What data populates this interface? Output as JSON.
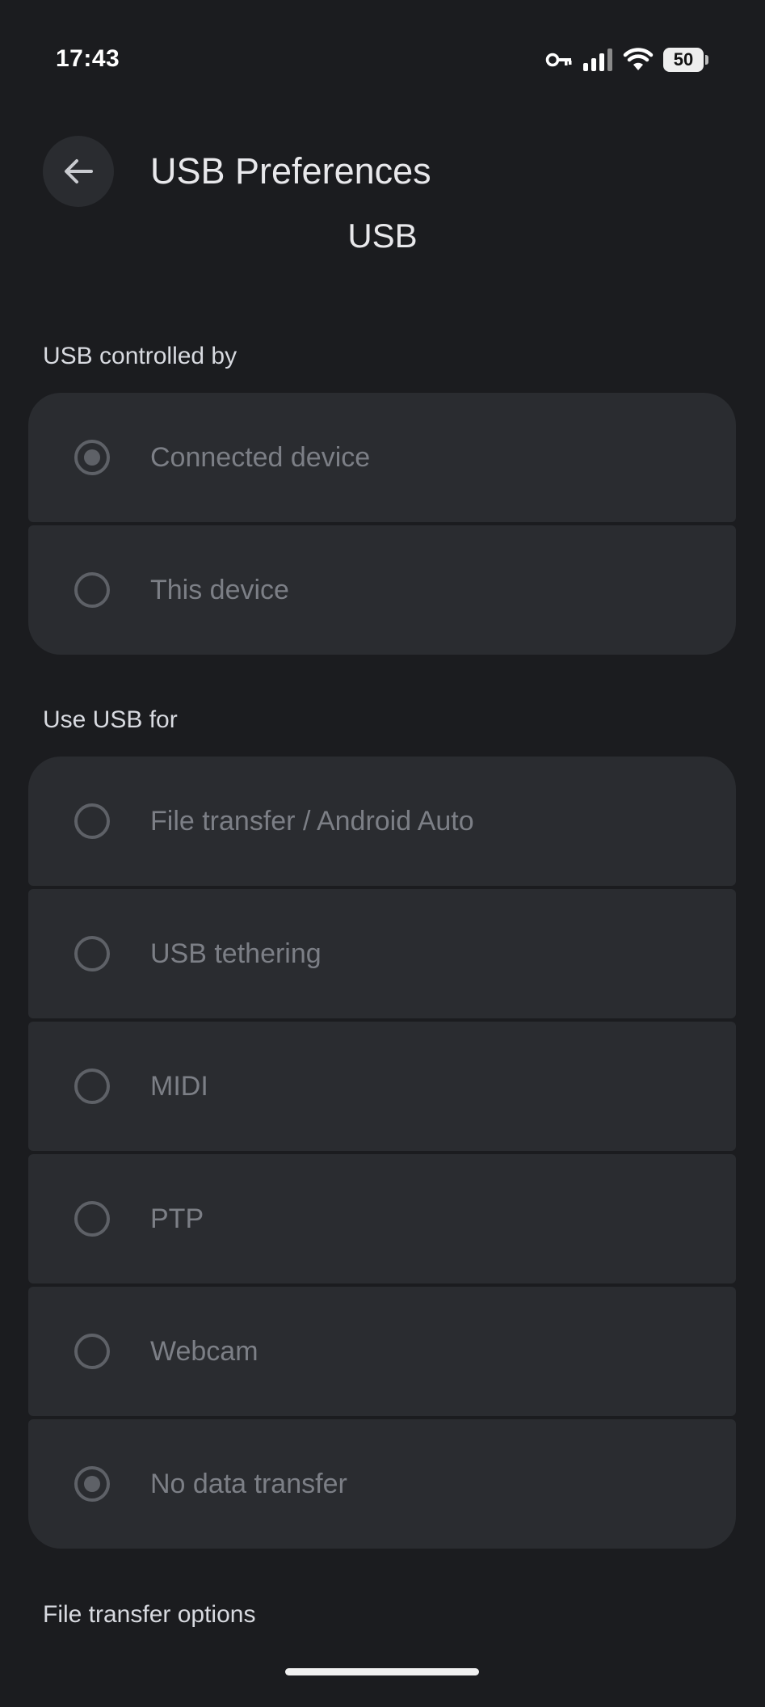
{
  "status_bar": {
    "time": "17:43",
    "battery_level": "50",
    "icons": [
      "vpn-key-icon",
      "cellular-signal-icon",
      "wifi-icon",
      "battery-icon"
    ]
  },
  "header": {
    "back_icon": "arrow-back-icon",
    "title": "USB Preferences",
    "subtitle": "USB"
  },
  "controlled_by": {
    "label": "USB controlled by",
    "options": [
      {
        "label": "Connected device",
        "checked": true
      },
      {
        "label": "This device",
        "checked": false
      }
    ]
  },
  "use_usb_for": {
    "label": "Use USB for",
    "options": [
      {
        "label": "File transfer / Android Auto",
        "checked": false
      },
      {
        "label": "USB tethering",
        "checked": false
      },
      {
        "label": "MIDI",
        "checked": false
      },
      {
        "label": "PTP",
        "checked": false
      },
      {
        "label": "Webcam",
        "checked": false
      },
      {
        "label": "No data transfer",
        "checked": true
      }
    ]
  },
  "file_transfer_options": {
    "label": "File transfer options"
  },
  "colors": {
    "background": "#1b1c1f",
    "card": "#2a2c30",
    "disabled_text": "#7c7f86",
    "radio": "#5e6167"
  }
}
